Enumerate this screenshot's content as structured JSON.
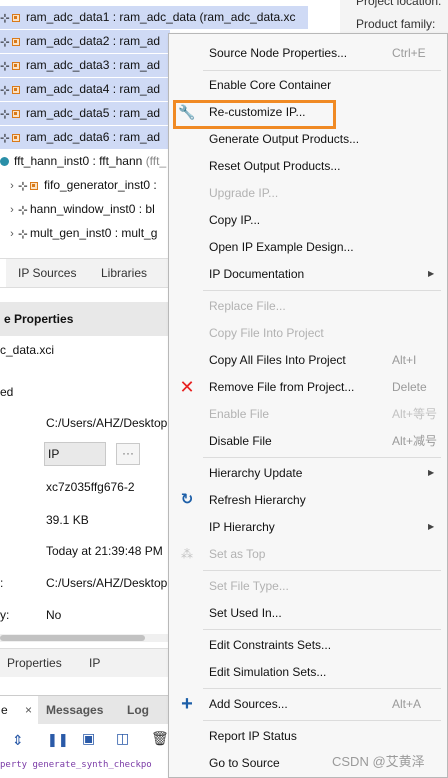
{
  "top_right": {
    "project_location_label": "Project location:",
    "product_family_label": "Product family:"
  },
  "tree": {
    "rows": [
      {
        "label": "ram_adc_data1 : ram_adc_data (ram_adc_data.xc",
        "selected": true
      },
      {
        "label": "ram_adc_data2 : ram_ad",
        "selected": true
      },
      {
        "label": "ram_adc_data3 : ram_ad",
        "selected": true
      },
      {
        "label": "ram_adc_data4 : ram_ad",
        "selected": true
      },
      {
        "label": "ram_adc_data5 : ram_ad",
        "selected": true
      },
      {
        "label": "ram_adc_data6 : ram_ad",
        "selected": true
      }
    ],
    "fft_row": {
      "label": "fft_hann_inst0 : fft_hann",
      "suffix": "(fft_"
    },
    "children": [
      {
        "label": "fifo_generator_inst0 :"
      },
      {
        "label": "hann_window_inst0 : bl"
      },
      {
        "label": "mult_gen_inst0 : mult_g"
      }
    ]
  },
  "source_tabs": {
    "ip_sources": "IP Sources",
    "libraries": "Libraries"
  },
  "properties": {
    "title": "e Properties",
    "filename": "c_data.xci",
    "status_partial": "ed",
    "rows": [
      {
        "label": "",
        "value": "C:/Users/AHZ/Desktop"
      },
      {
        "label": "",
        "value": "IP"
      },
      {
        "label": "",
        "value": "xc7z035ffg676-2"
      },
      {
        "label": "",
        "value": "39.1 KB"
      },
      {
        "label": "",
        "value": "Today at 21:39:48 PM"
      },
      {
        "label": ":",
        "value": "C:/Users/AHZ/Desktop"
      },
      {
        "label": "y:",
        "value": "No"
      }
    ],
    "ellipsis": "···"
  },
  "bottom_tabs": {
    "properties": "Properties",
    "ip": "IP"
  },
  "console_tabs": {
    "current": "e",
    "messages": "Messages",
    "log": "Log"
  },
  "console_text": "perty generate_synth_checkpo",
  "menu": {
    "items": [
      {
        "label": "Source Node Properties...",
        "shortcut": "Ctrl+E",
        "disabled": false
      },
      {
        "label": "Enable Core Container",
        "shortcut": "",
        "disabled": false
      },
      {
        "label": "Re-customize IP...",
        "shortcut": "",
        "disabled": false
      },
      {
        "label": "Generate Output Products...",
        "shortcut": "",
        "disabled": false
      },
      {
        "label": "Reset Output Products...",
        "shortcut": "",
        "disabled": false
      },
      {
        "label": "Upgrade IP...",
        "shortcut": "",
        "disabled": true
      },
      {
        "label": "Copy IP...",
        "shortcut": "",
        "disabled": false
      },
      {
        "label": "Open IP Example Design...",
        "shortcut": "",
        "disabled": false
      },
      {
        "label": "IP Documentation",
        "shortcut": "",
        "disabled": false
      },
      {
        "label": "Replace File...",
        "shortcut": "",
        "disabled": true
      },
      {
        "label": "Copy File Into Project",
        "shortcut": "",
        "disabled": true
      },
      {
        "label": "Copy All Files Into Project",
        "shortcut": "Alt+I",
        "disabled": false
      },
      {
        "label": "Remove File from Project...",
        "shortcut": "Delete",
        "disabled": false
      },
      {
        "label": "Enable File",
        "shortcut": "Alt+等号",
        "disabled": true
      },
      {
        "label": "Disable File",
        "shortcut": "Alt+减号",
        "disabled": false
      },
      {
        "label": "Hierarchy Update",
        "shortcut": "",
        "disabled": false
      },
      {
        "label": "Refresh Hierarchy",
        "shortcut": "",
        "disabled": false
      },
      {
        "label": "IP Hierarchy",
        "shortcut": "",
        "disabled": false
      },
      {
        "label": "Set as Top",
        "shortcut": "",
        "disabled": true
      },
      {
        "label": "Set File Type...",
        "shortcut": "",
        "disabled": true
      },
      {
        "label": "Set Used In...",
        "shortcut": "",
        "disabled": false
      },
      {
        "label": "Edit Constraints Sets...",
        "shortcut": "",
        "disabled": false
      },
      {
        "label": "Edit Simulation Sets...",
        "shortcut": "",
        "disabled": false
      },
      {
        "label": "Add Sources...",
        "shortcut": "Alt+A",
        "disabled": false
      },
      {
        "label": "Report IP Status",
        "shortcut": "",
        "disabled": false
      },
      {
        "label": "Go to Source",
        "shortcut": "",
        "disabled": false
      }
    ]
  },
  "watermark": "CSDN @艾黄泽",
  "colors": {
    "selection": "#cfdaf5",
    "highlight_box": "#f08a24",
    "remove_icon": "#e8201f",
    "add_icon": "#1d5fa8"
  }
}
